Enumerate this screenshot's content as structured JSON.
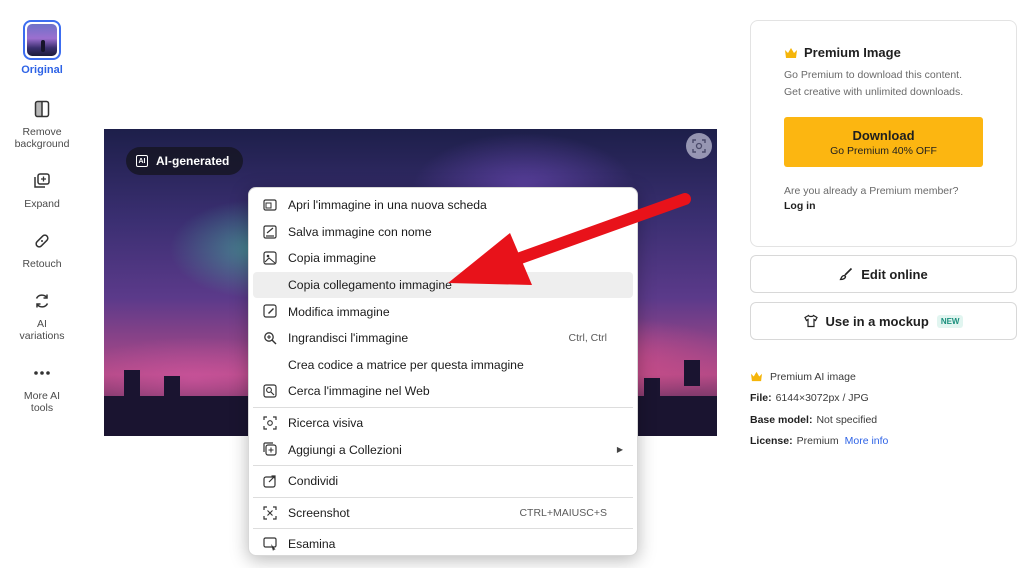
{
  "sidebar": {
    "items": [
      {
        "label": "Original",
        "icon": "image-thumbnail"
      },
      {
        "label": "Remove background",
        "icon": "remove-background-icon"
      },
      {
        "label": "Expand",
        "icon": "expand-icon"
      },
      {
        "label": "Retouch",
        "icon": "bandage-icon"
      },
      {
        "label": "AI variations",
        "icon": "refresh-icon"
      },
      {
        "label": "More AI tools",
        "icon": "more-dots-icon"
      }
    ]
  },
  "image": {
    "badge": "AI-generated"
  },
  "context_menu": {
    "items": [
      {
        "label": "Apri l'immagine in una nuova scheda",
        "icon": "new-tab-icon"
      },
      {
        "label": "Salva immagine con nome",
        "icon": "save-icon"
      },
      {
        "label": "Copia immagine",
        "icon": "copy-image-icon"
      },
      {
        "label": "Copia collegamento immagine",
        "icon": "",
        "highlighted": true
      },
      {
        "label": "Modifica immagine",
        "icon": "edit-image-icon"
      },
      {
        "label": "Ingrandisci l'immagine",
        "icon": "zoom-icon",
        "shortcut": "Ctrl, Ctrl"
      },
      {
        "label": "Crea codice a matrice per questa immagine",
        "icon": ""
      },
      {
        "label": "Cerca l'immagine nel Web",
        "icon": "search-image-icon"
      },
      {
        "label": "Ricerca visiva",
        "icon": "visual-search-icon"
      },
      {
        "label": "Aggiungi a Collezioni",
        "icon": "collections-icon",
        "submenu": true
      },
      {
        "label": "Condividi",
        "icon": "share-icon"
      },
      {
        "label": "Screenshot",
        "icon": "screenshot-icon",
        "shortcut": "CTRL+MAIUSC+S"
      },
      {
        "label": "Esamina",
        "icon": "inspect-icon"
      }
    ]
  },
  "premium": {
    "title": "Premium Image",
    "line1": "Go Premium to download this content.",
    "line2": "Get creative with unlimited downloads.",
    "download_label": "Download",
    "download_sub": "Go Premium 40% OFF",
    "member_question": "Are you already a Premium member?",
    "login": "Log in"
  },
  "actions": {
    "edit_online": "Edit online",
    "mockup": "Use in a mockup",
    "mockup_badge": "NEW"
  },
  "meta": {
    "premium_ai": "Premium AI image",
    "file_label": "File:",
    "file_value": "6144×3072px / JPG",
    "model_label": "Base model:",
    "model_value": "Not specified",
    "license_label": "License:",
    "license_value": "Premium",
    "more_info": "More info"
  },
  "colors": {
    "accent": "#2e63e6",
    "download": "#fcb611",
    "arrow": "#e8121a",
    "crown": "#f5b50a"
  }
}
